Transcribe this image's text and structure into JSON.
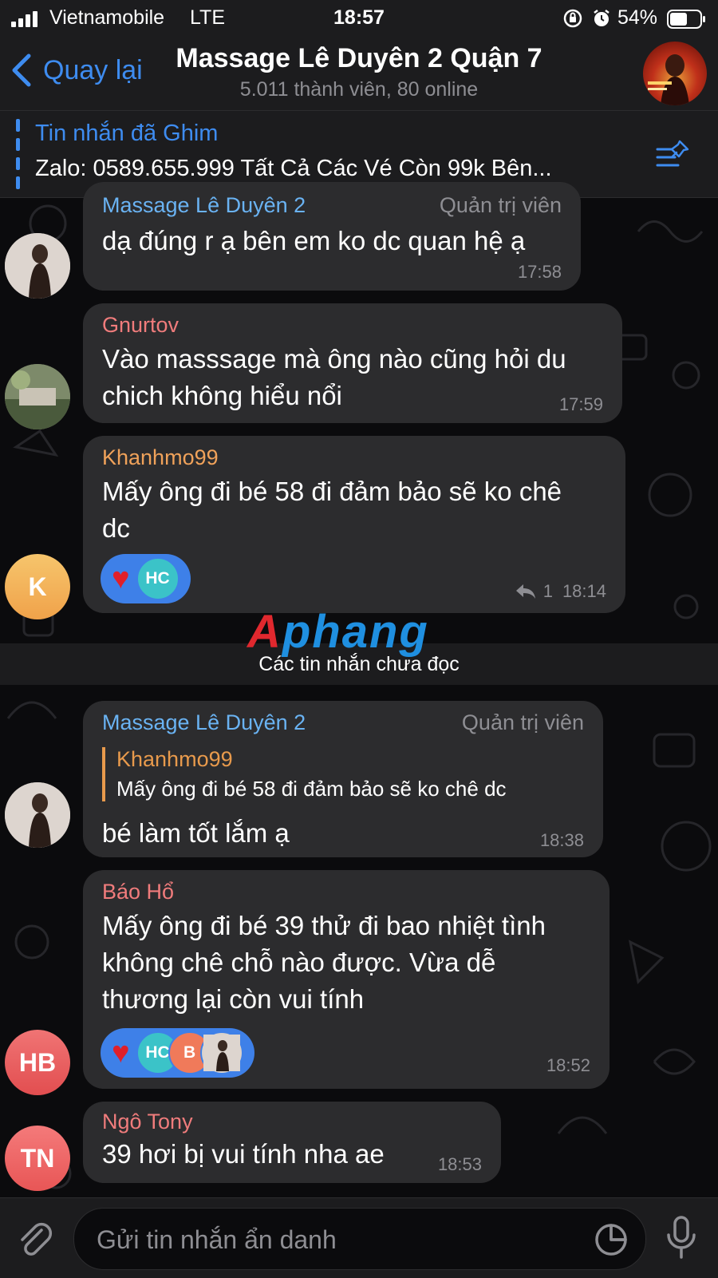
{
  "status_bar": {
    "carrier": "Vietnamobile",
    "network": "LTE",
    "time": "18:57",
    "battery": "54%"
  },
  "header": {
    "back_label": "Quay lại",
    "title": "Massage Lê Duyên 2 Quận 7",
    "subtitle": "5.011 thành viên, 80 online"
  },
  "pinned": {
    "title": "Tin nhắn đã Ghim",
    "text": "Zalo: 0589.655.999 Tất Cả Các Vé Còn 99k Bên..."
  },
  "messages": [
    {
      "sender": "Massage Lê Duyên 2",
      "role": "Quản trị viên",
      "text": "dạ đúng r ạ bên em ko dc quan hệ ạ",
      "time": "17:58",
      "sender_color": "#6ab3f3"
    },
    {
      "sender": "Gnurtov",
      "text_line1": "Vào masssage mà ông nào cũng hỏi du",
      "text_line2": "chich không hiểu nổi",
      "time": "17:59",
      "sender_color": "#f07c7c"
    },
    {
      "sender": "Khanhmo99",
      "text_line1": "Mấy ông đi bé 58 đi đảm bảo sẽ ko chê",
      "text_line2": "dc",
      "time": "18:14",
      "reply_count": "1",
      "avatar_initials": "K",
      "reactions": [
        "HC"
      ],
      "sender_color": "#f0a25a"
    },
    {
      "sender": "Massage Lê Duyên 2",
      "role": "Quản trị viên",
      "quote_name": "Khanhmo99",
      "quote_text": "Mấy ông đi bé 58 đi đảm bảo sẽ ko chê dc",
      "text": "bé làm tốt lắm ạ",
      "time": "18:38",
      "sender_color": "#6ab3f3"
    },
    {
      "sender": "Báo Hổ",
      "text_line1": "Mấy ông đi bé 39 thử đi bao nhiệt tình",
      "text_line2": "không chê chỗ nào được. Vừa dễ",
      "text_line3": "thương lại còn vui tính",
      "time": "18:52",
      "avatar_initials": "HB",
      "reactions": [
        "HC",
        "B"
      ],
      "sender_color": "#f07c7c"
    },
    {
      "sender": "Ngô Tony",
      "text": "39 hơi bị  vui tính nha ae",
      "time": "18:53",
      "avatar_initials": "TN",
      "sender_color": "#f07c7c"
    }
  ],
  "unread_divider": "Các tin nhắn chưa đọc",
  "watermark": {
    "first": "A",
    "rest": "phang"
  },
  "input": {
    "placeholder": "Gửi tin nhắn ẩn danh"
  },
  "colors": {
    "accent": "#3e8cf0",
    "bubble": "#2c2c2e",
    "background": "#0b0b0d",
    "reaction_pill": "#3e80e8",
    "heart": "#e0202a",
    "hc_avatar": "#3bc3c8",
    "b_avatar": "#f07a5a",
    "k_avatar": "#f4b75a",
    "hb_avatar": "#ec5e5e",
    "tn_avatar": "#f06565"
  },
  "icons": [
    "signal-icon",
    "lock-rotation-icon",
    "alarm-icon",
    "battery-icon",
    "chevron-left-icon",
    "pin-list-icon",
    "reply-icon",
    "heart-icon",
    "paperclip-icon",
    "sticker-icon",
    "microphone-icon"
  ]
}
